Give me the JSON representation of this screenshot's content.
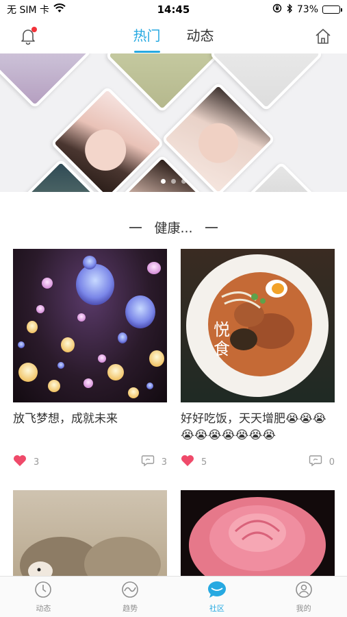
{
  "status_bar": {
    "carrier": "无 SIM 卡",
    "time": "14:45",
    "battery": "73%",
    "battery_level": 0.73
  },
  "top_nav": {
    "tabs": [
      {
        "label": "热门",
        "active": true
      },
      {
        "label": "动态",
        "active": false
      }
    ],
    "icons": [
      "bell-icon",
      "home-icon"
    ]
  },
  "banner": {
    "page_count": 3,
    "current_page": 0
  },
  "section": {
    "title": "健康..."
  },
  "cards": [
    {
      "title": "放飞梦想，成就未来",
      "likes": "3",
      "comments": "3",
      "image": "lanterns"
    },
    {
      "title": "好好吃饭，天天增肥😭😭😭😭😭😭😭😭😭😭",
      "likes": "5",
      "comments": "0",
      "image": "ramen",
      "image_text": "悦食"
    }
  ],
  "thumbnails": [
    "hedgehogs",
    "pink-rose"
  ],
  "tab_bar": {
    "items": [
      {
        "label": "动态",
        "icon": "clock-icon",
        "active": false
      },
      {
        "label": "趋势",
        "icon": "trend-icon",
        "active": false
      },
      {
        "label": "社区",
        "icon": "chat-bubble-icon",
        "active": true
      },
      {
        "label": "我的",
        "icon": "profile-icon",
        "active": false
      }
    ]
  },
  "colors": {
    "accent": "#27a9e1",
    "heart": "#ef4a6a",
    "badge": "#f2333a"
  }
}
